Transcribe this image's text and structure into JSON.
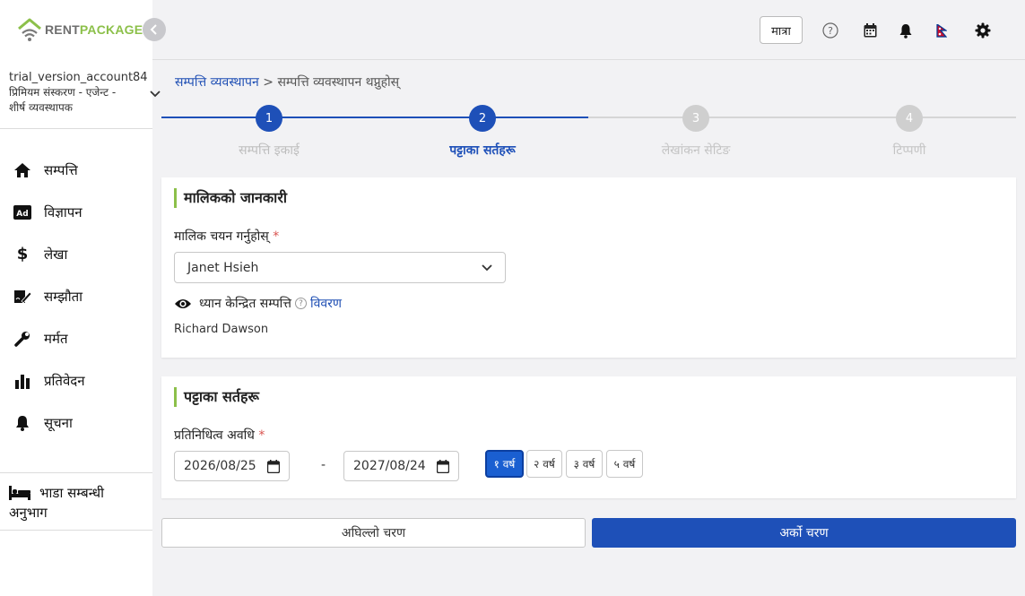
{
  "brand": {
    "rent": "RENT",
    "package": "PACKAGE"
  },
  "account": {
    "name": "trial_version_account84",
    "role": "प्रिमियम संस्करण - एजेन्ट - शीर्ष व्यवस्थापक"
  },
  "sidebar": {
    "items": [
      {
        "label": "सम्पत्ति",
        "icon": "home-icon"
      },
      {
        "label": "विज्ञापन",
        "icon": "ad-icon"
      },
      {
        "label": "लेखा",
        "icon": "dollar-icon"
      },
      {
        "label": "सम्झौता",
        "icon": "contract-icon"
      },
      {
        "label": "मर्मत",
        "icon": "wrench-icon"
      },
      {
        "label": "प्रतिवेदन",
        "icon": "bar-chart-icon"
      },
      {
        "label": "सूचना",
        "icon": "bell-icon"
      }
    ],
    "rent_section": {
      "line1": "भाडा सम्बन्धी",
      "line2": "अनुभाग",
      "icon": "bed-icon"
    }
  },
  "topbar": {
    "mode_label": "मात्रा",
    "icons": [
      "help-icon",
      "calendar-icon",
      "notification-bell-icon",
      "flag-nepal-icon",
      "settings-gear-icon"
    ]
  },
  "breadcrumb": {
    "root": "सम्पत्ति व्यवस्थापन",
    "separator": ">",
    "current": "सम्पत्ति व्यवस्थापन थप्नुहोस्"
  },
  "stepper": {
    "steps": [
      {
        "number": "1",
        "label": "सम्पत्ति इकाई"
      },
      {
        "number": "2",
        "label": "पट्टाका सर्तहरू"
      },
      {
        "number": "3",
        "label": "लेखांकन सेटिङ"
      },
      {
        "number": "4",
        "label": "टिप्पणी"
      }
    ],
    "current_step": 2
  },
  "owner_card": {
    "title": "मालिकको जानकारी",
    "select_label": "मालिक चयन गर्नुहोस्",
    "required_mark": "*",
    "selected_owner": "Janet Hsieh",
    "focus_label": "ध्यान केन्द्रित सम्पत्ति",
    "help_mark": "?",
    "detail_link": "विवरण",
    "focus_owner": "Richard Dawson"
  },
  "lease_card": {
    "title": "पट्टाका सर्तहरू",
    "period_label": "प्रतिनिधित्व अवधि",
    "required_mark": "*",
    "start_date": "2026/08/25",
    "end_date": "2027/08/24",
    "dash": "-",
    "year_options": [
      "१ वर्ष",
      "२ वर्ष",
      "३ वर्ष",
      "५ वर्ष"
    ],
    "selected_year_index": 0
  },
  "footer": {
    "prev_label": "अघिल्लो चरण",
    "next_label": "अर्को चरण"
  },
  "colors": {
    "primary": "#1e50b8",
    "accent_green": "#8cc04a",
    "background": "#f2f2f4"
  }
}
